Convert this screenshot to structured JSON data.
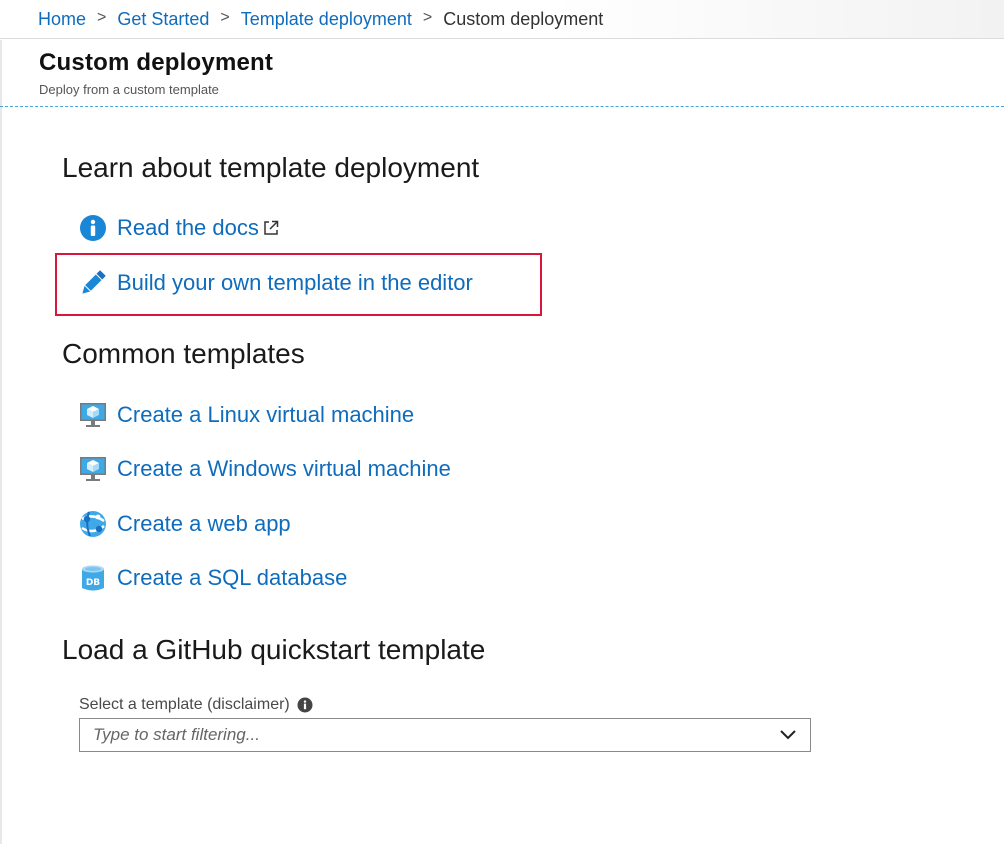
{
  "breadcrumb": {
    "items": [
      "Home",
      "Get Started",
      "Template deployment"
    ],
    "current": "Custom deployment",
    "separator": ">"
  },
  "header": {
    "title": "Custom deployment",
    "subtitle": "Deploy from a custom template"
  },
  "learn": {
    "heading": "Learn about template deployment",
    "links": [
      {
        "label": "Read the docs",
        "icon": "info-icon",
        "external": true
      },
      {
        "label": "Build your own template in the editor",
        "icon": "pencil-icon",
        "highlighted": true
      }
    ]
  },
  "common": {
    "heading": "Common templates",
    "links": [
      {
        "label": "Create a Linux virtual machine",
        "icon": "virtual-machine-icon"
      },
      {
        "label": "Create a Windows virtual machine",
        "icon": "virtual-machine-icon"
      },
      {
        "label": "Create a web app",
        "icon": "web-app-icon"
      },
      {
        "label": "Create a SQL database",
        "icon": "sql-database-icon"
      }
    ]
  },
  "github": {
    "heading": "Load a GitHub quickstart template",
    "select_label": "Select a template (disclaimer)",
    "select_placeholder": "Type to start filtering..."
  },
  "colors": {
    "link": "#0f6cbd",
    "highlight_border": "#d9163b",
    "header_divider": "#4aa3d8"
  }
}
